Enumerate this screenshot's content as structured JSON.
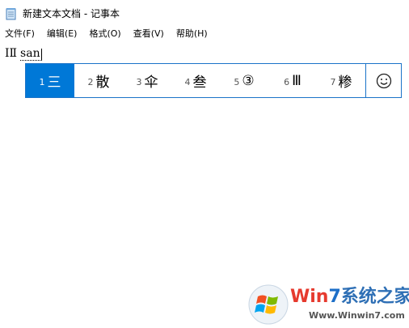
{
  "window": {
    "title": "新建文本文档 - 记事本",
    "icon": "notepad-icon"
  },
  "menu": [
    {
      "label": "文件(F)"
    },
    {
      "label": "编辑(E)"
    },
    {
      "label": "格式(O)"
    },
    {
      "label": "查看(V)"
    },
    {
      "label": "帮助(H)"
    }
  ],
  "editor": {
    "typed_text": "ⅠⅡ",
    "composition": "san"
  },
  "ime": {
    "selected_index": 0,
    "candidates": [
      {
        "num": "1",
        "text": "三"
      },
      {
        "num": "2",
        "text": "散"
      },
      {
        "num": "3",
        "text": "伞"
      },
      {
        "num": "4",
        "text": "叁"
      },
      {
        "num": "5",
        "text": "③"
      },
      {
        "num": "6",
        "text": "Ⅲ"
      },
      {
        "num": "7",
        "text": "糁"
      }
    ],
    "emoji_icon": "smiley-icon",
    "accent_color": "#0078d7"
  },
  "watermark": {
    "brand_part1": "Win",
    "brand_part2": "7",
    "brand_part3": "系统之家",
    "url": "Www.Winwin7.com"
  }
}
